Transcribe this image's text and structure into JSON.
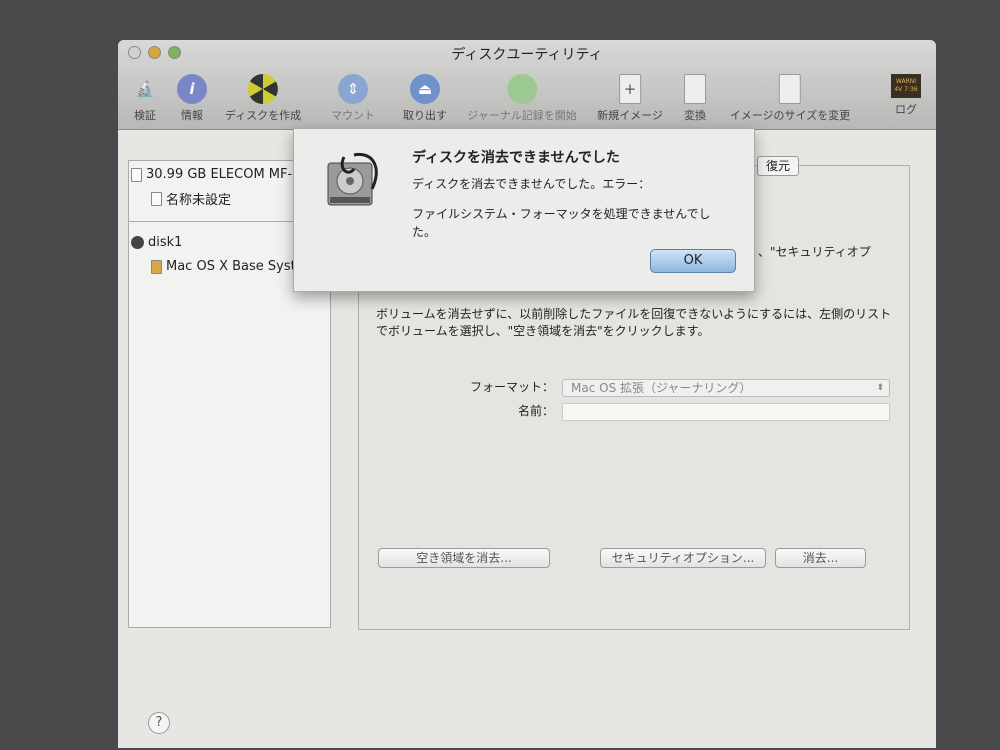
{
  "window": {
    "title": "ディスクユーティリティ"
  },
  "toolbar": [
    {
      "label": "検証",
      "icon": "microscope-icon"
    },
    {
      "label": "情報",
      "icon": "info-icon"
    },
    {
      "label": "ディスクを作成",
      "icon": "burn-icon"
    },
    {
      "label": "マウント",
      "icon": "mount-icon"
    },
    {
      "label": "取り出す",
      "icon": "eject-icon"
    },
    {
      "label": "ジャーナル記録を開始",
      "icon": "journal-icon"
    },
    {
      "label": "新規イメージ",
      "icon": "new-image-icon"
    },
    {
      "label": "変換",
      "icon": "convert-icon"
    },
    {
      "label": "イメージのサイズを変更",
      "icon": "resize-image-icon"
    },
    {
      "label": "ログ",
      "icon": "log-icon",
      "badge": "WARNI\n4V 7:36"
    }
  ],
  "sidebar": {
    "items": [
      {
        "label": "30.99 GB ELECOM MF-"
      },
      {
        "label": "名称未設定"
      },
      {
        "label": "disk1"
      },
      {
        "label": "Mac OS X Base Syst"
      }
    ]
  },
  "main": {
    "tab_restore": "復元",
    "partial_text": "、\"セキュリティオプ",
    "description": "ボリュームを消去せずに、以前削除したファイルを回復できないようにするには、左側のリストでボリュームを選択し、\"空き領域を消去\"をクリックします。",
    "format_label": "フォーマット：",
    "format_value": "Mac OS 拡張（ジャーナリング）",
    "name_label": "名前：",
    "name_value": "",
    "erase_free_space": "空き領域を消去...",
    "security_options": "セキュリティオプション...",
    "erase": "消去..."
  },
  "help": "?",
  "dialog": {
    "title": "ディスクを消去できませんでした",
    "message1": "ディスクを消去できませんでした。エラー：",
    "message2": "ファイルシステム・フォーマッタを処理できませんでした。",
    "ok": "OK"
  }
}
